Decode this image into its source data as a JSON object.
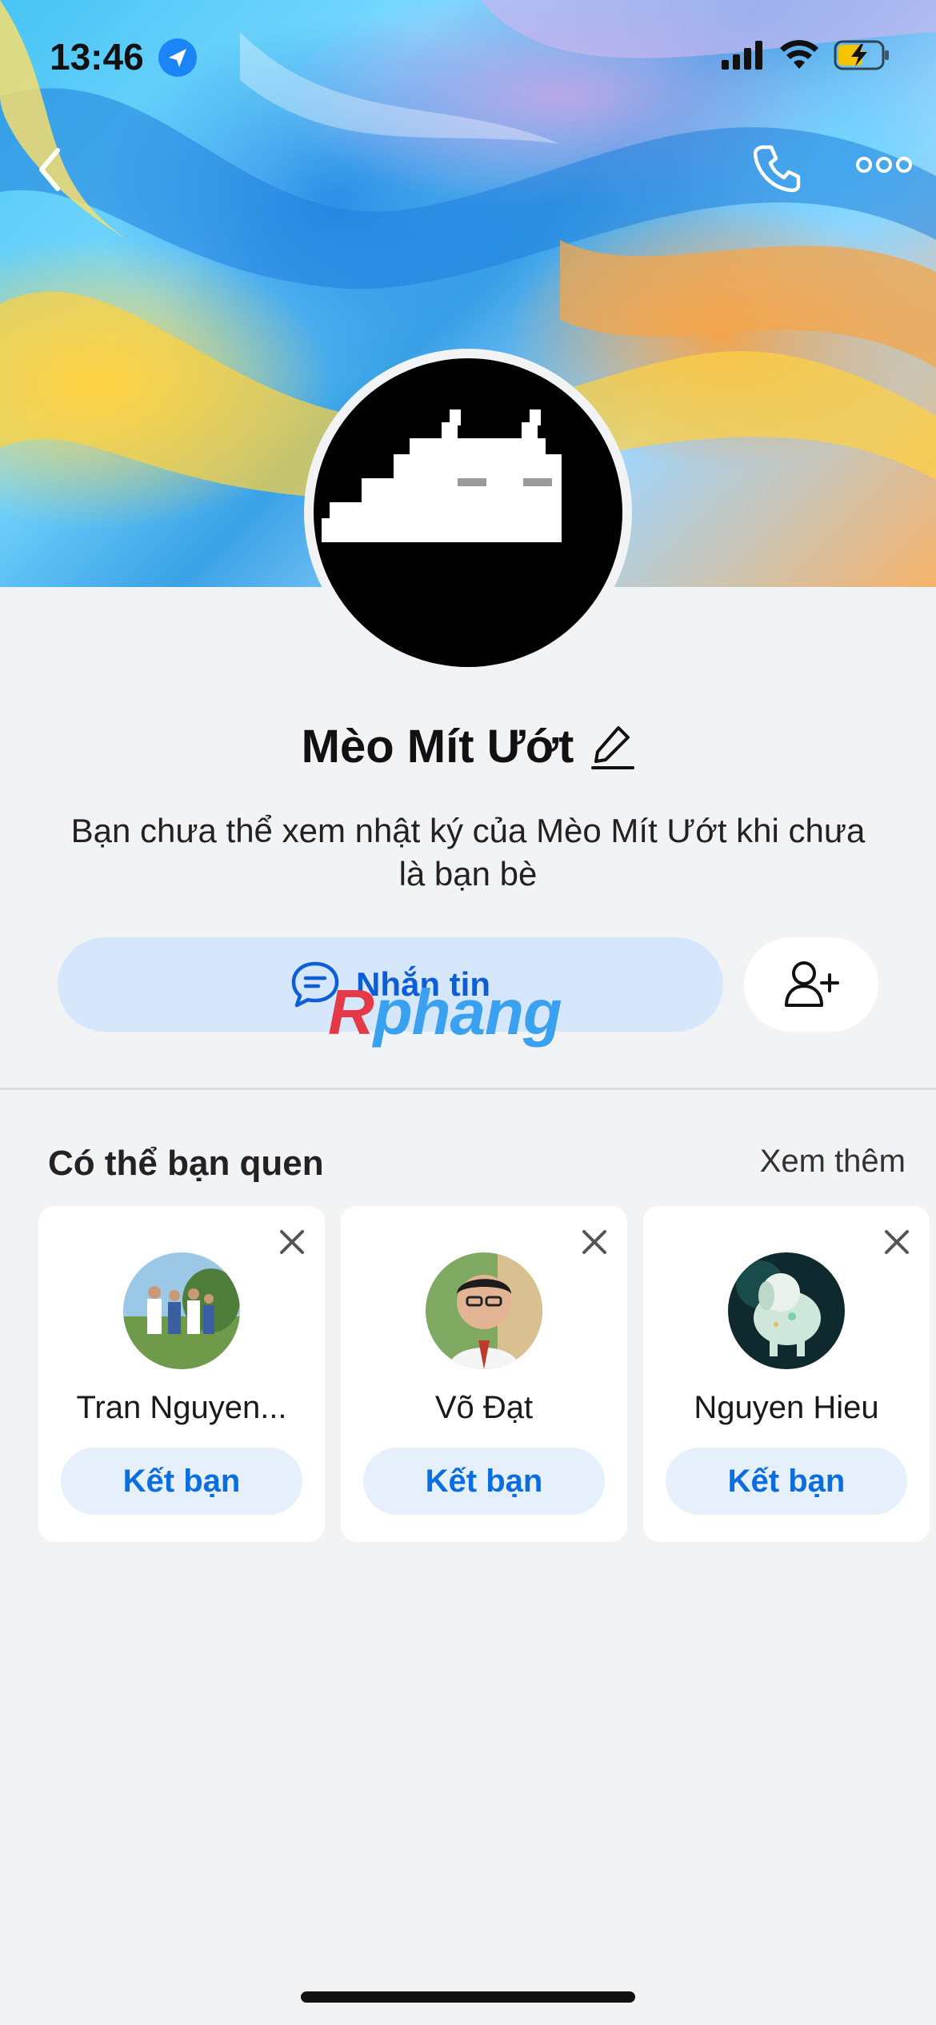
{
  "status_bar": {
    "time": "13:46"
  },
  "profile": {
    "name": "Mèo Mít Ướt",
    "info_text": "Bạn chưa thể xem nhật ký của Mèo Mít Ướt khi chưa là bạn bè"
  },
  "actions": {
    "message_label": "Nhắn tin"
  },
  "watermark": {
    "part1": "R",
    "part2": "phang"
  },
  "suggestions": {
    "title": "Có thể bạn quen",
    "see_more": "Xem thêm",
    "items": [
      {
        "name": "Tran Nguyen...",
        "button": "Kết bạn"
      },
      {
        "name": "Võ Đạt",
        "button": "Kết bạn"
      },
      {
        "name": "Nguyen Hieu",
        "button": "Kết bạn"
      }
    ]
  },
  "colors": {
    "accent": "#0b6ee0",
    "primary_button_bg": "#d6e6fb"
  }
}
